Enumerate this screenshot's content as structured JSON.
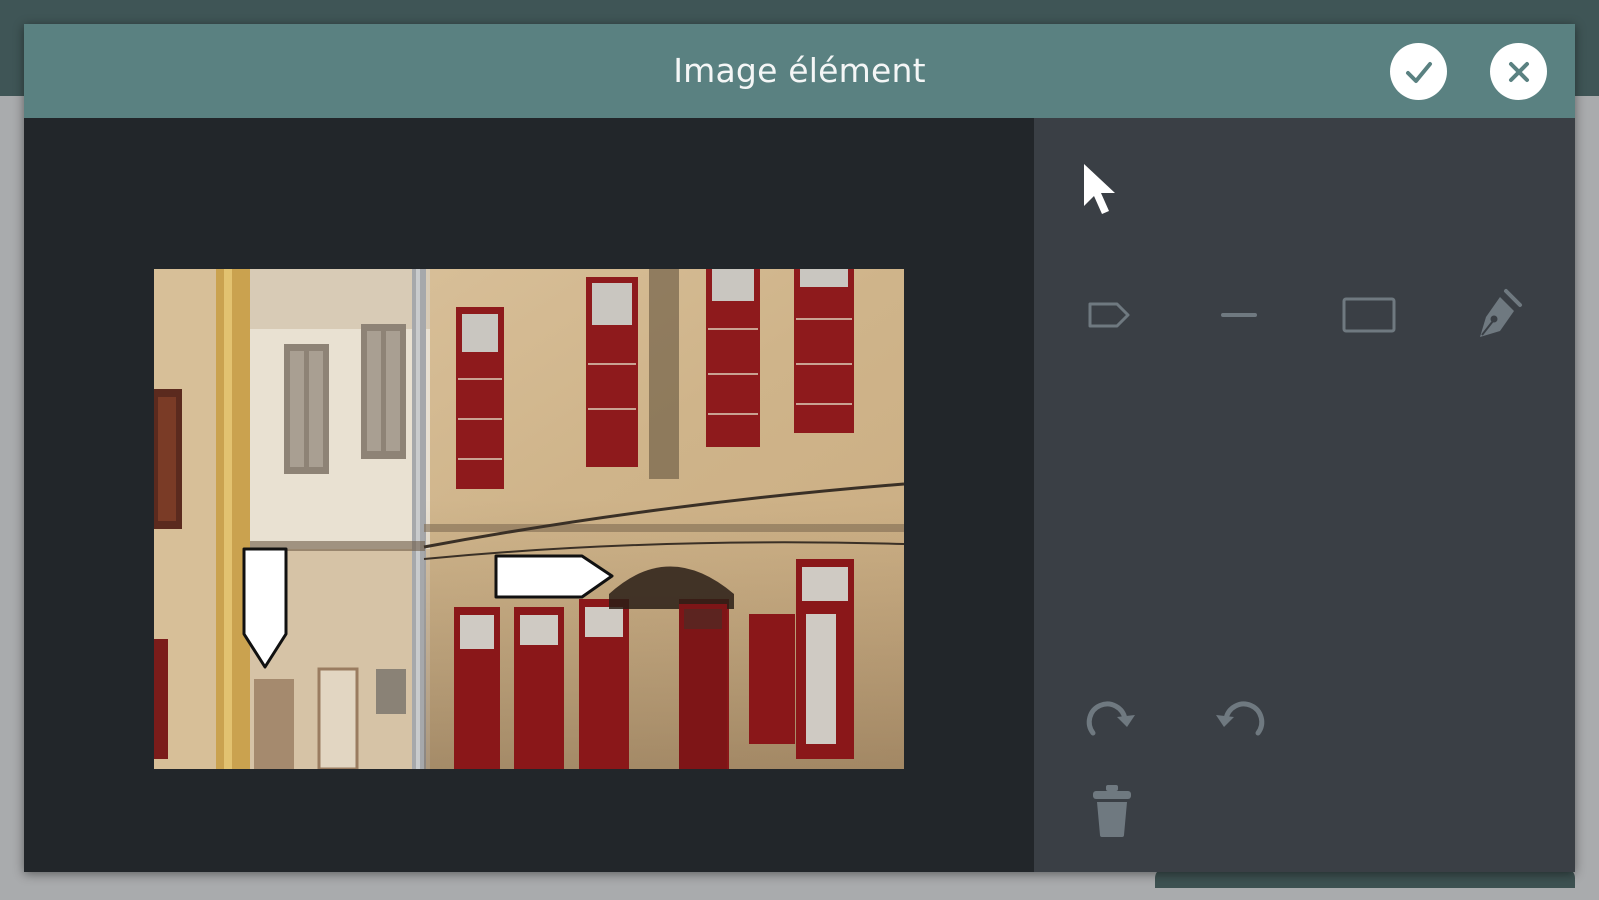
{
  "dialog": {
    "title": "Image élément"
  },
  "header": {
    "confirm_icon": "check-icon",
    "close_icon": "close-icon"
  },
  "toolbar": {
    "select_tool_icon": "pointer-cursor-icon",
    "shapes": [
      {
        "name": "label-tag-icon"
      },
      {
        "name": "line-icon"
      },
      {
        "name": "rectangle-icon"
      },
      {
        "name": "pen-icon"
      }
    ],
    "redo_icon": "redo-icon",
    "undo_icon": "undo-icon",
    "delete_icon": "trash-icon"
  },
  "colors": {
    "header": "#5a8181",
    "canvas_bg": "#22262a",
    "panel_bg": "#3a3f45",
    "icon_inactive": "#6f7980",
    "icon_active": "#ffffff",
    "shutter_red": "#8e1a1c",
    "wall": "#d8bf9a"
  }
}
